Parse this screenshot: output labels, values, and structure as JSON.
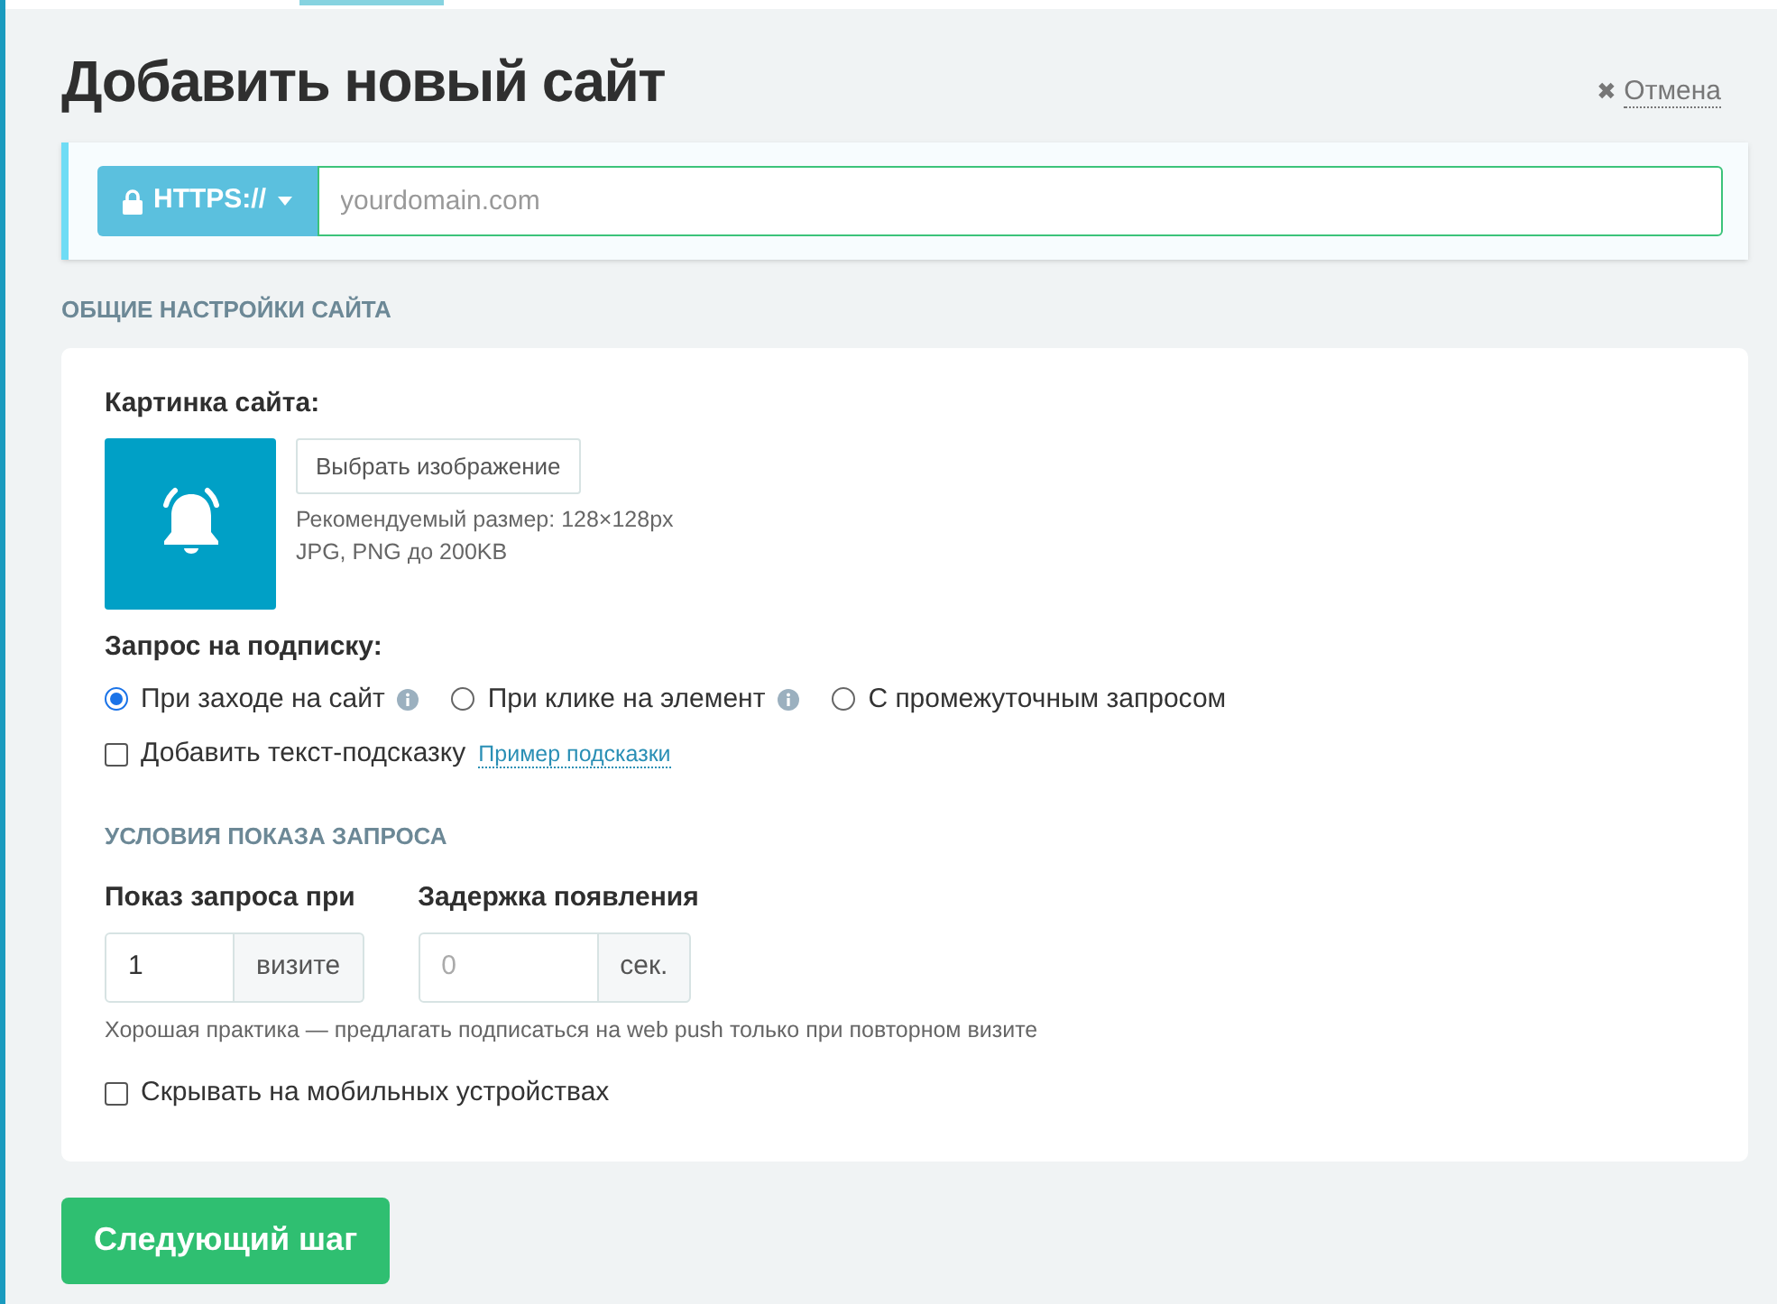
{
  "title": "Добавить новый сайт",
  "cancel": {
    "icon": "✖",
    "label": "Отмена"
  },
  "url": {
    "protocol": "HTTPS://",
    "placeholder": "yourdomain.com"
  },
  "general_heading": "ОБЩИЕ НАСТРОЙКИ САЙТА",
  "image": {
    "label": "Картинка сайта:",
    "button": "Выбрать изображение",
    "hints": [
      "Рекомендуемый размер: 128×128px",
      "JPG, PNG до 200KB"
    ]
  },
  "subscription": {
    "label": "Запрос на подписку:",
    "options": [
      {
        "label": "При заходе на сайт",
        "selected": true,
        "info": true
      },
      {
        "label": "При клике на элемент",
        "selected": false,
        "info": true
      },
      {
        "label": "С промежуточным запросом",
        "selected": false,
        "info": false
      }
    ]
  },
  "hint_checkbox": {
    "label": "Добавить текст-подсказку",
    "checked": false,
    "link": "Пример подсказки"
  },
  "conditions_heading": "УСЛОВИЯ ПОКАЗА ЗАПРОСА",
  "fields": [
    {
      "label": "Показ запроса при",
      "value": "1",
      "addon": "визите"
    },
    {
      "label": "Задержка появления",
      "placeholder": "0",
      "addon": "сек."
    }
  ],
  "practice_note": "Хорошая практика — предлагать подписаться на web push только при повторном визите",
  "mobile_checkbox": {
    "label": "Скрывать на мобильных устройствах",
    "checked": false
  },
  "next_button": "Следующий шаг"
}
